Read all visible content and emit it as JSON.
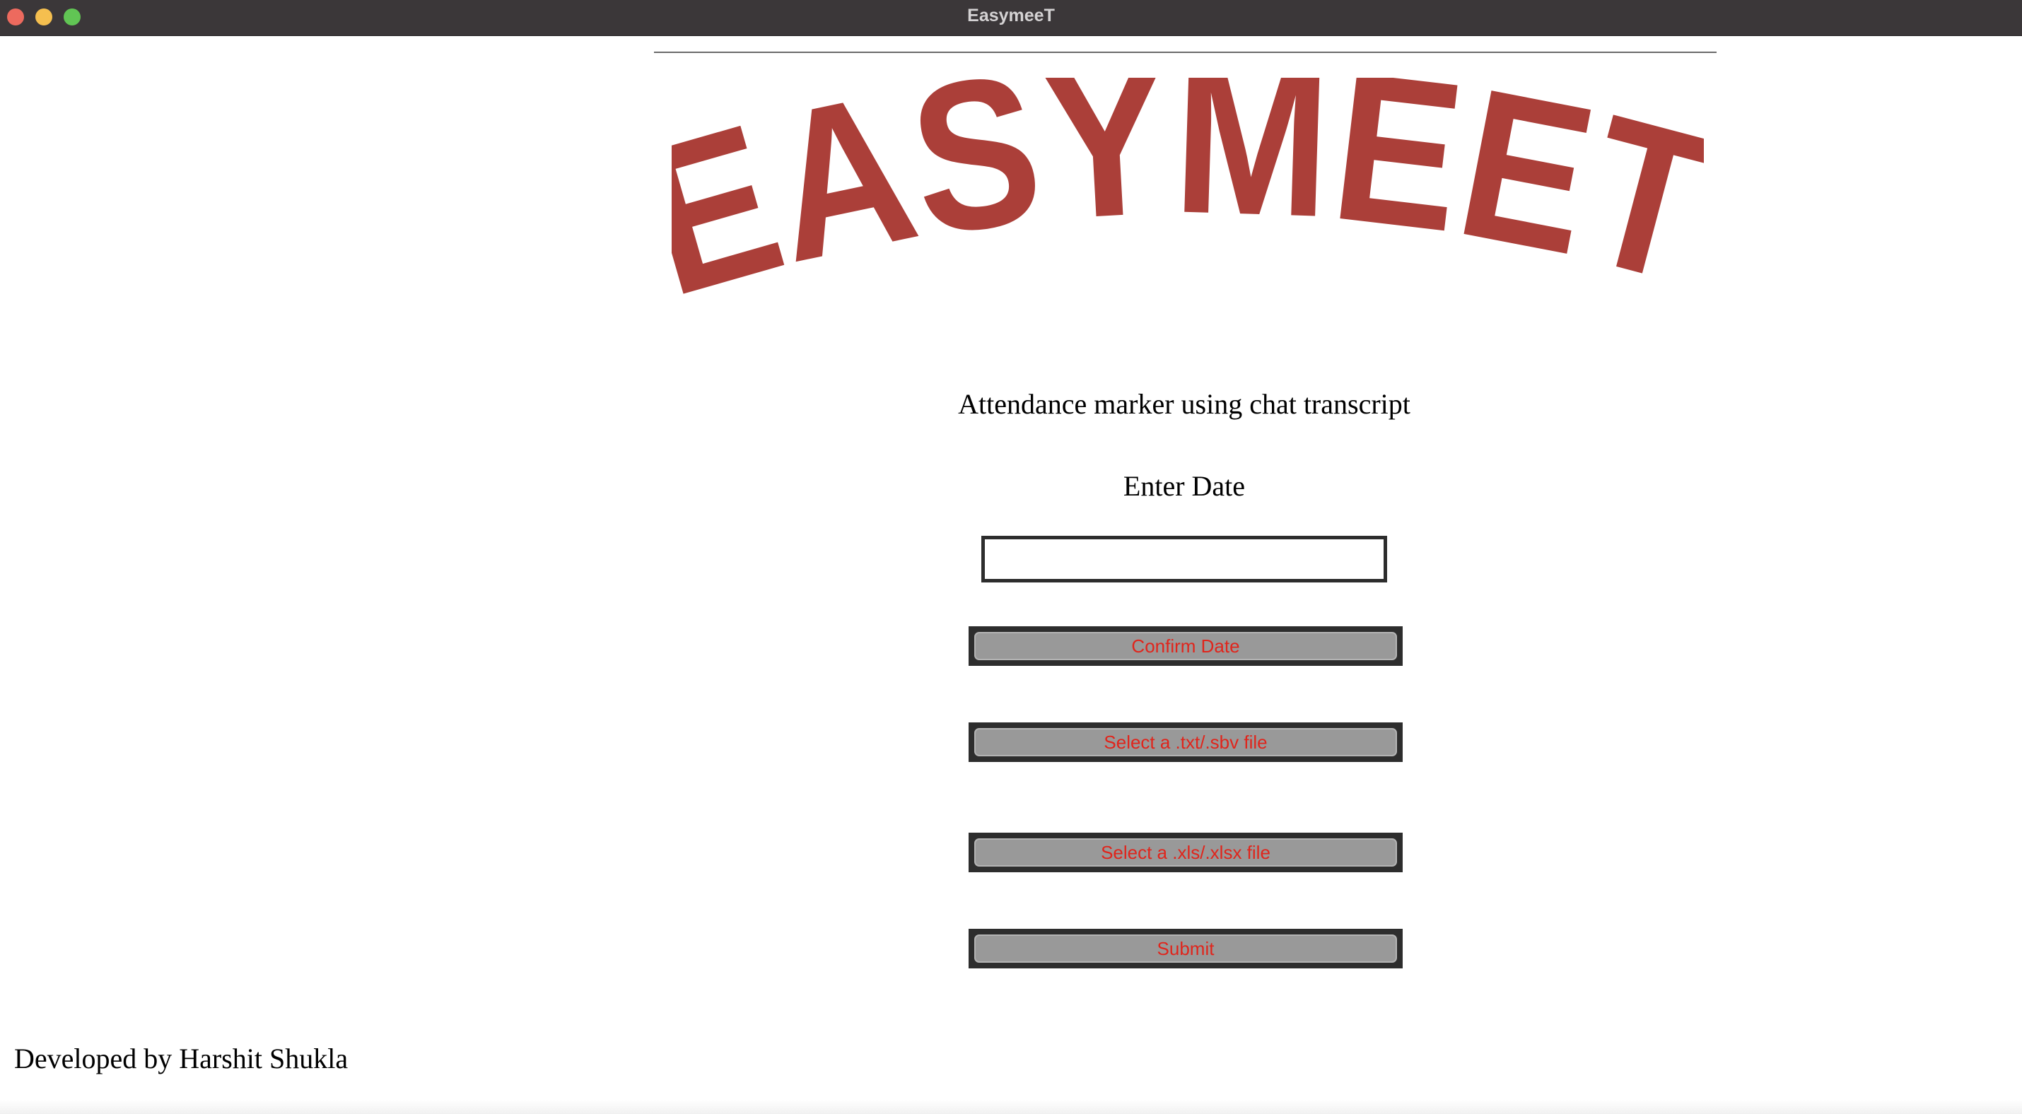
{
  "window": {
    "title": "EasymeeT"
  },
  "logo": {
    "text": "EASYMEET",
    "color": "#ab3f39"
  },
  "header": {
    "subtitle": "Attendance marker using chat transcript"
  },
  "form": {
    "date_label": "Enter Date",
    "date_value": "",
    "confirm_date_label": "Confirm Date",
    "select_transcript_label": "Select a .txt/.sbv file",
    "select_sheet_label": "Select a .xls/.xlsx file",
    "submit_label": "Submit"
  },
  "footer": {
    "credit": "Developed by Harshit Shukla"
  },
  "colors": {
    "titlebar": "#3b3739",
    "button_text": "#e0251c",
    "button_face": "#999999",
    "button_frame": "#2d2d2d"
  }
}
